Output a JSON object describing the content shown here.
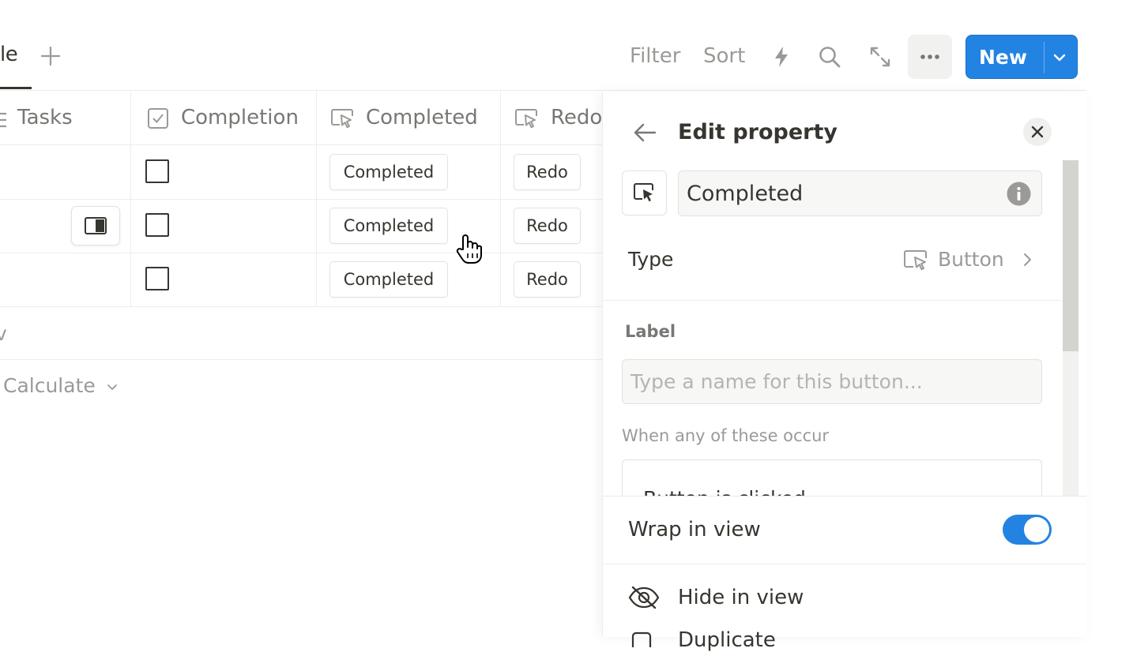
{
  "toolbar": {
    "view_tab": "le",
    "filter": "Filter",
    "sort": "Sort",
    "new_label": "New",
    "icons": {
      "add_view": "plus-icon",
      "automation": "lightning-icon",
      "search": "search-icon",
      "expand": "expand-icon",
      "more": "more-icon",
      "new_menu": "chevron-down-icon"
    }
  },
  "table": {
    "columns": [
      {
        "label": "Tasks",
        "icon": "list-icon"
      },
      {
        "label": "Completion",
        "icon": "checkbox-icon"
      },
      {
        "label": "Completed",
        "icon": "button-cursor-icon"
      },
      {
        "label": "Redo",
        "icon": "button-cursor-icon"
      }
    ],
    "rows": [
      {
        "checked": false,
        "completed_button": "Completed",
        "redo_button": "Redo"
      },
      {
        "checked": false,
        "completed_button": "Completed",
        "redo_button": "Redo"
      },
      {
        "checked": false,
        "completed_button": "Completed",
        "redo_button": "Redo"
      }
    ],
    "new_row": "v",
    "calculate": "Calculate"
  },
  "panel": {
    "title": "Edit property",
    "name_value": "Completed",
    "type_label": "Type",
    "type_value": "Button",
    "label_title": "Label",
    "label_placeholder": "Type a name for this button...",
    "when_title": "When any of these occur",
    "trigger_text": "Button is clicked",
    "wrap_label": "Wrap in view",
    "wrap_enabled": true,
    "hide_label": "Hide in view",
    "duplicate_label": "Duplicate"
  },
  "colors": {
    "accent": "#2383e2",
    "text": "#37352f",
    "muted": "#9b9a97",
    "border": "#ededeb"
  }
}
